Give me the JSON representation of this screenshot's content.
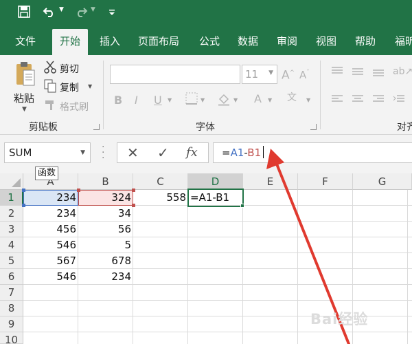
{
  "quick_access": {
    "icons": [
      "save-icon",
      "undo-icon",
      "redo-icon",
      "customize-qat-icon"
    ]
  },
  "tabs": [
    "文件",
    "开始",
    "插入",
    "页面布局",
    "公式",
    "数据",
    "审阅",
    "视图",
    "帮助",
    "福昕"
  ],
  "active_tab": "开始",
  "ribbon": {
    "clipboard": {
      "paste_label": "粘贴",
      "cut_label": "剪切",
      "copy_label": "复制",
      "format_painter_label": "格式刷",
      "group_label": "剪贴板"
    },
    "font": {
      "font_name_value": "",
      "font_size_value": "11",
      "group_label": "字体"
    },
    "alignment": {
      "group_label": "对齐"
    }
  },
  "formula_bar": {
    "name_box_value": "SUM",
    "formula_prefix": "=",
    "formula_ref1": "A1",
    "formula_op": "-",
    "formula_ref2": "B1",
    "tooltip": "函数"
  },
  "sheet": {
    "columns": [
      "A",
      "B",
      "C",
      "D",
      "E",
      "F",
      "G"
    ],
    "rows": [
      "1",
      "2",
      "3",
      "4",
      "5",
      "6",
      "7",
      "8",
      "9",
      "10"
    ],
    "cells": {
      "A1": "234",
      "B1": "324",
      "C1": "558",
      "D1": "=A1-B1",
      "A2": "234",
      "B2": "34",
      "A3": "456",
      "B3": "56",
      "A4": "546",
      "B4": "5",
      "A5": "567",
      "B5": "678",
      "A6": "546",
      "B6": "234"
    },
    "active_cell": "D1"
  },
  "colors": {
    "accent": "#217346",
    "ref1": "#4472c4",
    "ref2": "#c0504d",
    "annotation_arrow": "#e03a2f"
  },
  "watermark": "Bai经验"
}
